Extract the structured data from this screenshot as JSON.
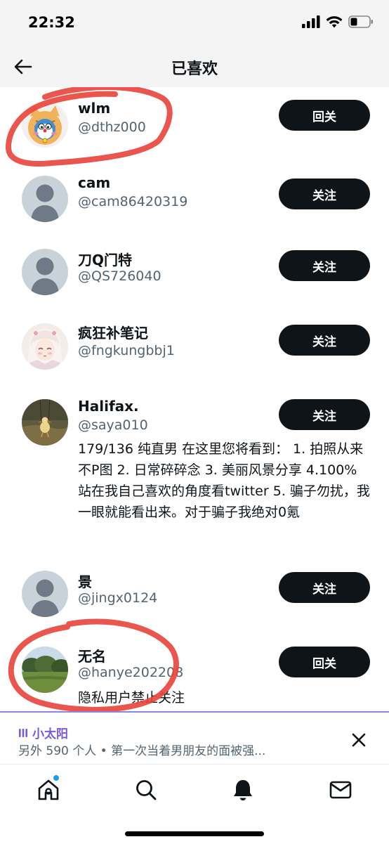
{
  "status_bar": {
    "time": "22:32"
  },
  "nav": {
    "title": "已喜欢"
  },
  "users": [
    {
      "name": "wlm",
      "handle": "@dthz000",
      "button": "回关",
      "bio": "",
      "avatar": "cartoon-tiger-cat"
    },
    {
      "name": "cam",
      "handle": "@cam86420319",
      "button": "关注",
      "bio": "",
      "avatar": "default"
    },
    {
      "name": "刀Q门特",
      "handle": "@QS726040",
      "button": "关注",
      "bio": "",
      "avatar": "default"
    },
    {
      "name": "疯狂补笔记",
      "handle": "@fngkungbbj1",
      "button": "关注",
      "bio": "",
      "avatar": "anime-girl"
    },
    {
      "name": "Halifax.",
      "handle": "@saya010",
      "button": "关注",
      "bio": "179/136 纯直男 在这里您将看到： 1. 拍照从来不P图 2. 日常碎碎念 3. 美丽风景分享 4.100%站在我自己喜欢的角度看twitter 5. 骗子勿扰，我一眼就能看出来。对于骗子我绝对0氪",
      "avatar": "duck-on-swing"
    },
    {
      "name": "景",
      "handle": "@jingx0124",
      "button": "关注",
      "bio": "",
      "avatar": "default"
    },
    {
      "name": "无名",
      "handle": "@hanye202208",
      "button": "回关",
      "bio": "隐私用户禁止关注",
      "avatar": "park-landscape"
    }
  ],
  "notification": {
    "title": "小太阳",
    "text": "另外 590 个人 • 第一次当着男朋友的面被强..."
  },
  "tabs": [
    "home",
    "search",
    "notifications",
    "messages"
  ],
  "colors": {
    "button_bg": "#0f1419",
    "secondary_text": "#536471",
    "annotation_red": "#e8423a",
    "notification_purple": "#7a5bd6",
    "header_bg": "#f4f4f5"
  }
}
